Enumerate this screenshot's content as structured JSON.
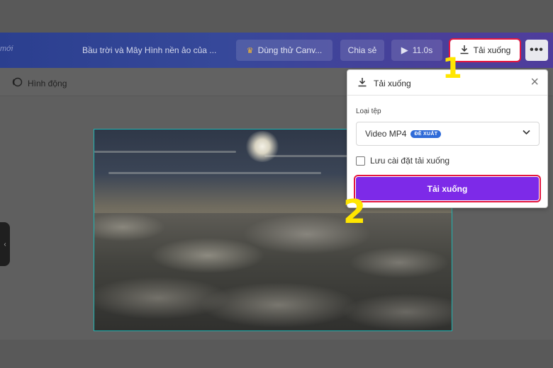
{
  "topbar": {
    "brand_fragment": "mới",
    "document_title": "Bầu trời và Mây Hình nền ảo của ...",
    "try_button": "Dùng thử Canv...",
    "share_button": "Chia sẻ",
    "play_duration": "11.0s",
    "download_button": "Tải xuống",
    "more_button": "•••"
  },
  "toolbar": {
    "animate_label": "Hình động"
  },
  "download_panel": {
    "title": "Tải xuống",
    "file_type_label": "Loại tệp",
    "selected_file_type": "Video MP4",
    "recommended_badge": "ĐỀ XUẤT",
    "save_settings_label": "Lưu cài đặt tải xuống",
    "save_settings_checked": false,
    "download_button": "Tải xuống"
  },
  "annotations": {
    "step_1": "1",
    "step_2": "2"
  },
  "colors": {
    "accent_purple": "#7d2ae8",
    "highlight_red": "#e5173f",
    "step_yellow": "#ffe600",
    "selection_teal": "#1fb5b3"
  }
}
